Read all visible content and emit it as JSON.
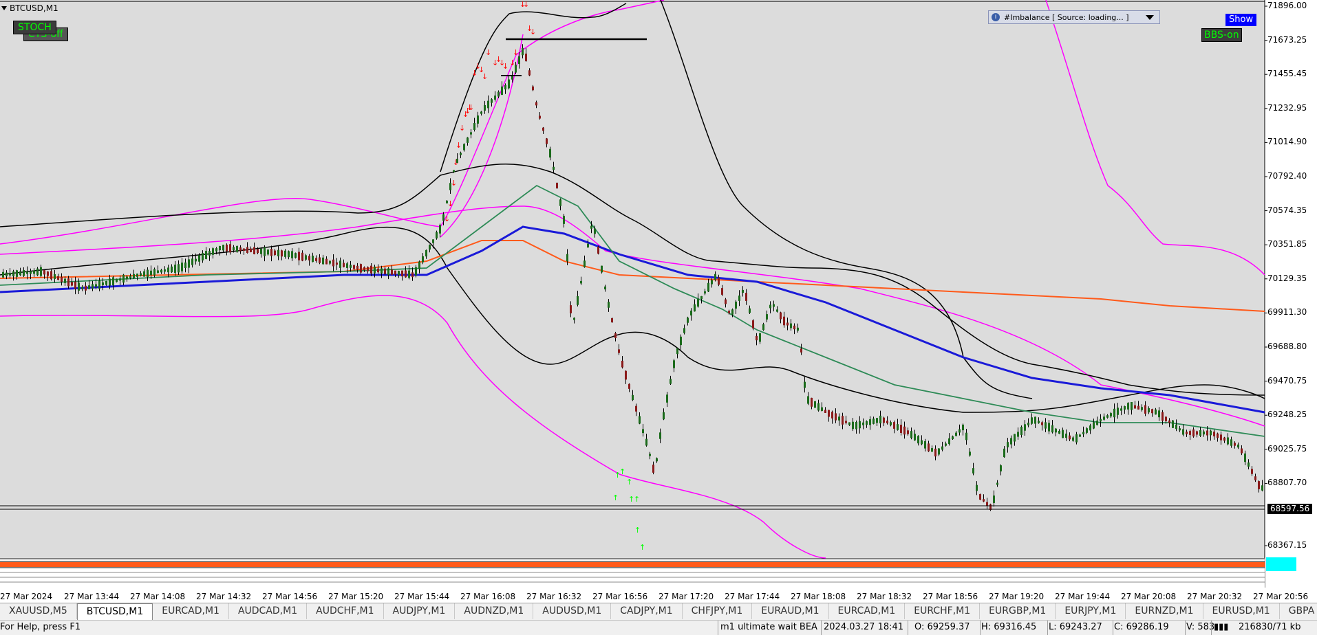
{
  "chart": {
    "symbol": "BTCUSD,M1",
    "buttons": {
      "stoch": "STOCH",
      "cts": "CTS-off",
      "bbs": "BBS-on",
      "show": "Show"
    },
    "indicator_dropdown": "#Imbalance [ Source: loading... ]",
    "price_axis": [
      "71896.00",
      "71673.25",
      "71455.45",
      "71232.95",
      "71014.90",
      "70792.40",
      "70574.35",
      "70351.85",
      "70129.35",
      "69911.30",
      "69688.80",
      "69470.75",
      "69248.25",
      "69025.75",
      "68807.70",
      "68597.56",
      "68367.15"
    ],
    "current_price": "68597.56",
    "time_axis": [
      "27 Mar 2024",
      "27 Mar 13:44",
      "27 Mar 14:08",
      "27 Mar 14:32",
      "27 Mar 14:56",
      "27 Mar 15:20",
      "27 Mar 15:44",
      "27 Mar 16:08",
      "27 Mar 16:32",
      "27 Mar 16:56",
      "27 Mar 17:20",
      "27 Mar 17:44",
      "27 Mar 18:08",
      "27 Mar 18:32",
      "27 Mar 18:56",
      "27 Mar 19:20",
      "27 Mar 19:44",
      "27 Mar 20:08",
      "27 Mar 20:32",
      "27 Mar 20:56"
    ],
    "colors": {
      "background": "#dcdcdc",
      "bull_candle": "#1b6b1b",
      "bear_candle": "#8b1a1a",
      "ma_fast": "#2e8b57",
      "ma_mid": "#1a1ad8",
      "ma_slow": "#ff5a1a",
      "bands_outer": "#ff00ff",
      "bands_inner": "#000000",
      "arrow_down": "#ff0000",
      "arrow_up": "#00ff00"
    }
  },
  "tabs": [
    "XAUUSD,M5",
    "BTCUSD,M1",
    "EURCAD,M1",
    "AUDCAD,M1",
    "AUDCHF,M1",
    "AUDJPY,M1",
    "AUDNZD,M1",
    "AUDUSD,M1",
    "CADJPY,M1",
    "CHFJPY,M1",
    "EURAUD,M1",
    "EURCAD,M1",
    "EURCHF,M1",
    "EURGBP,M1",
    "EURJPY,M1",
    "EURNZD,M1",
    "EURUSD,M1",
    "GBPA"
  ],
  "active_tab": "BTCUSD,M1",
  "status": {
    "help": "For Help, press F1",
    "profile": "m1 ultimate wait BEA",
    "datetime": "2024.03.27 18:41",
    "open": "O: 69259.37",
    "high": "H: 69316.45",
    "low": "L: 69243.27",
    "close": "C: 69286.19",
    "volume": "V: 583",
    "traffic": "216830/71 kb"
  }
}
